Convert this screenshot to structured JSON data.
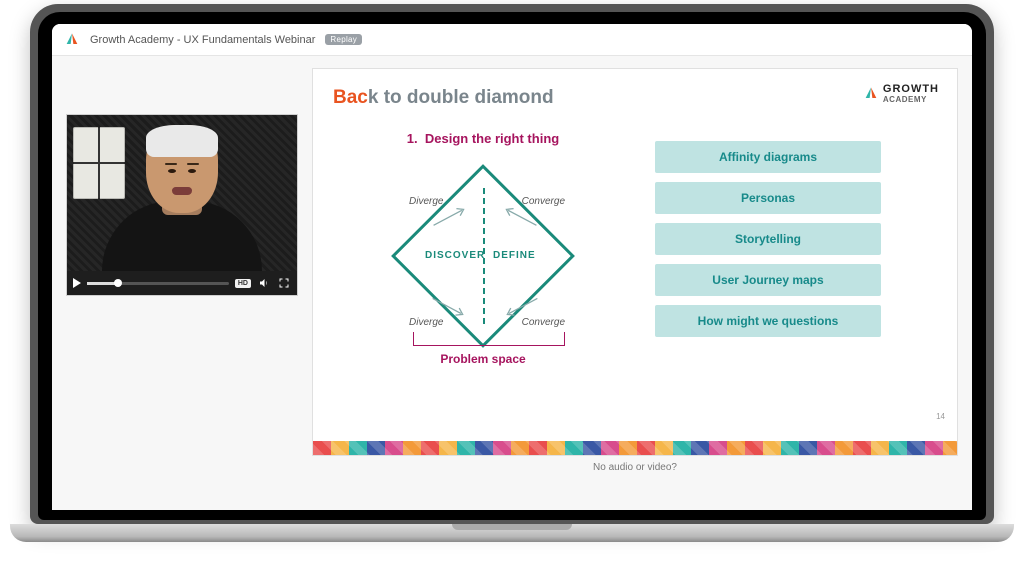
{
  "header": {
    "title": "Growth Academy - UX Fundamentals Webinar",
    "badge": "Replay"
  },
  "player": {
    "quality_badge": "HD",
    "progress_pct": 22
  },
  "slide": {
    "title_accent": "Bac",
    "title_rest": "k to double diamond",
    "brand_main": "GROWTH",
    "brand_sub": "ACADEMY",
    "step_number": "1.",
    "step_text": "Design the right thing",
    "diverge_label": "Diverge",
    "converge_label": "Converge",
    "discover_label": "DISCOVER",
    "define_label": "DEFINE",
    "problem_space": "Problem space",
    "methods": [
      "Affinity diagrams",
      "Personas",
      "Storytelling",
      "User Journey maps",
      "How might we questions"
    ],
    "page_number": "14"
  },
  "help_link": "No audio or video?"
}
